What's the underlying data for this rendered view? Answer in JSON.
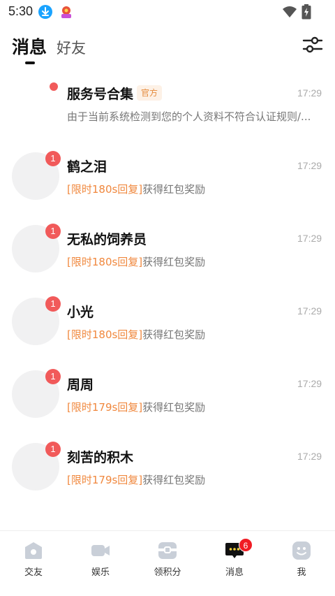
{
  "status_bar": {
    "time": "5:30"
  },
  "header": {
    "tabs": [
      {
        "label": "消息",
        "active": true
      },
      {
        "label": "好友",
        "active": false
      }
    ]
  },
  "conversations": [
    {
      "name": "服务号合集",
      "tag": "官方",
      "time": "17:29",
      "preview": "由于当前系统检测到您的个人资料不符合认证规则/..."
    },
    {
      "name": "鹤之泪",
      "badge": "1",
      "time": "17:29",
      "highlight": "[限时180s回复]",
      "preview": "获得红包奖励"
    },
    {
      "name": "无私的饲养员",
      "badge": "1",
      "time": "17:29",
      "highlight": "[限时180s回复]",
      "preview": "获得红包奖励"
    },
    {
      "name": "小光",
      "badge": "1",
      "time": "17:29",
      "highlight": "[限时180s回复]",
      "preview": "获得红包奖励"
    },
    {
      "name": "周周",
      "badge": "1",
      "time": "17:29",
      "highlight": "[限时179s回复]",
      "preview": "获得红包奖励"
    },
    {
      "name": "刻苦的积木",
      "badge": "1",
      "time": "17:29",
      "highlight": "[限时179s回复]",
      "preview": "获得红包奖励"
    }
  ],
  "bottom_nav": [
    {
      "label": "交友",
      "icon": "home-icon"
    },
    {
      "label": "娱乐",
      "icon": "video-camera-icon"
    },
    {
      "label": "领积分",
      "icon": "gift-box-icon"
    },
    {
      "label": "消息",
      "icon": "chat-bubble-icon",
      "badge": "6",
      "active": true
    },
    {
      "label": "我",
      "icon": "smile-face-icon"
    }
  ],
  "colors": {
    "accent_orange": "#f0883e",
    "badge_red": "#f15a5a",
    "nav_icon_gray": "#c9cfd8"
  }
}
